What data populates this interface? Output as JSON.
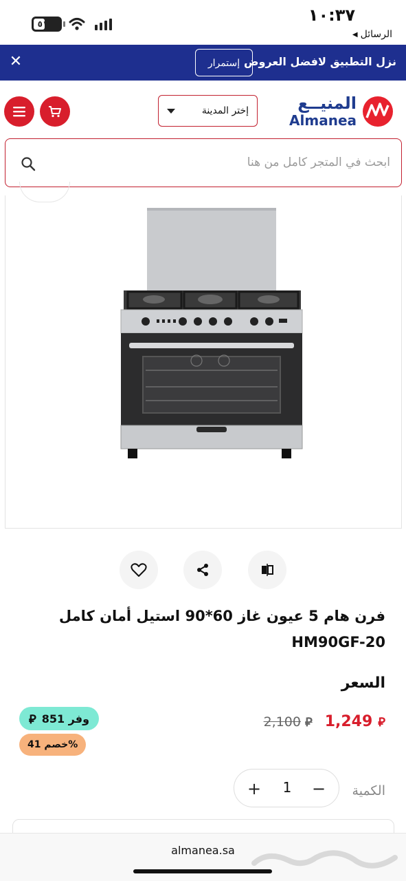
{
  "status_bar": {
    "time": "١٠:٣٧",
    "back_app": "الرسائل",
    "battery": "٥١"
  },
  "promo": {
    "text": "نزل التطبيق لافضل العروض",
    "button": "إستمرار",
    "background": "#1e2f8f"
  },
  "header": {
    "logo_ar": "المنيــع",
    "logo_en": "Almanea",
    "city_select": "إختر المدينة",
    "brand_color": "#d81e2c"
  },
  "search": {
    "placeholder": "ابحث في المتجر كامل من هنا"
  },
  "product": {
    "title": "فرن هام 5 عيون غاز 60*90 استيل أمان كامل HM90GF-20",
    "price_label": "السعر",
    "price_new": "1,249",
    "price_old": "2,100",
    "save_text": "وفر 851",
    "discount_text": "خصم 41%",
    "quantity_label": "الكمية",
    "quantity_value": "1"
  },
  "browser": {
    "url": "almanea.sa"
  },
  "icons": {
    "close": "close-icon",
    "menu": "menu-icon",
    "cart": "cart-icon",
    "search": "search-icon",
    "wishlist": "heart-icon",
    "share": "share-icon",
    "compare": "compare-icon"
  }
}
